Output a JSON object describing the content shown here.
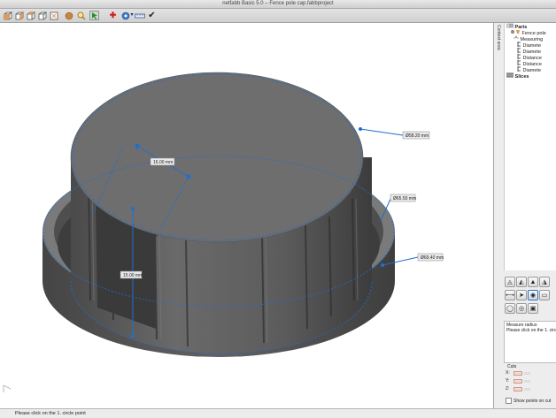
{
  "window": {
    "title": "netfabb Basic 5.0 – Fence pole cap.fabbproject"
  },
  "toolbar": {
    "icons": [
      "view-front-icon",
      "view-side-icon",
      "view-top-icon",
      "view-iso-icon",
      "view-zoom-icon",
      "shading-icon",
      "magnify-icon",
      "select-pointer-icon",
      "add-part-icon",
      "repair-icon",
      "measure-ruler-icon",
      "checkmark-icon"
    ]
  },
  "viewport": {
    "measurements": {
      "d1": "Ø58.20 mm",
      "d2": "Ø65.50 mm",
      "d3": "Ø69.40 mm",
      "dist1": "16.00 mm",
      "dist2": "15.00 mm"
    }
  },
  "sidebar": {
    "tab_label": "Context area",
    "tree": {
      "parts": "Parts",
      "part_name": "Fence pole",
      "measuring": "Measuring",
      "items": [
        "Diamete",
        "Diamete",
        "Distance",
        "Distance",
        "Diamete"
      ],
      "slices": "Slices"
    },
    "message": {
      "title": "Measure radius",
      "text": "Please click on the 1. circle poi"
    },
    "cuts": {
      "title": "Cuts",
      "x": "X:",
      "y": "Y:",
      "z": "Z:",
      "show_points": "Show points on cut"
    }
  },
  "status": {
    "text": "Please click on the 1. circle point"
  },
  "colors": {
    "accent": "#1f6fd0",
    "model": "#5a5a5a"
  }
}
